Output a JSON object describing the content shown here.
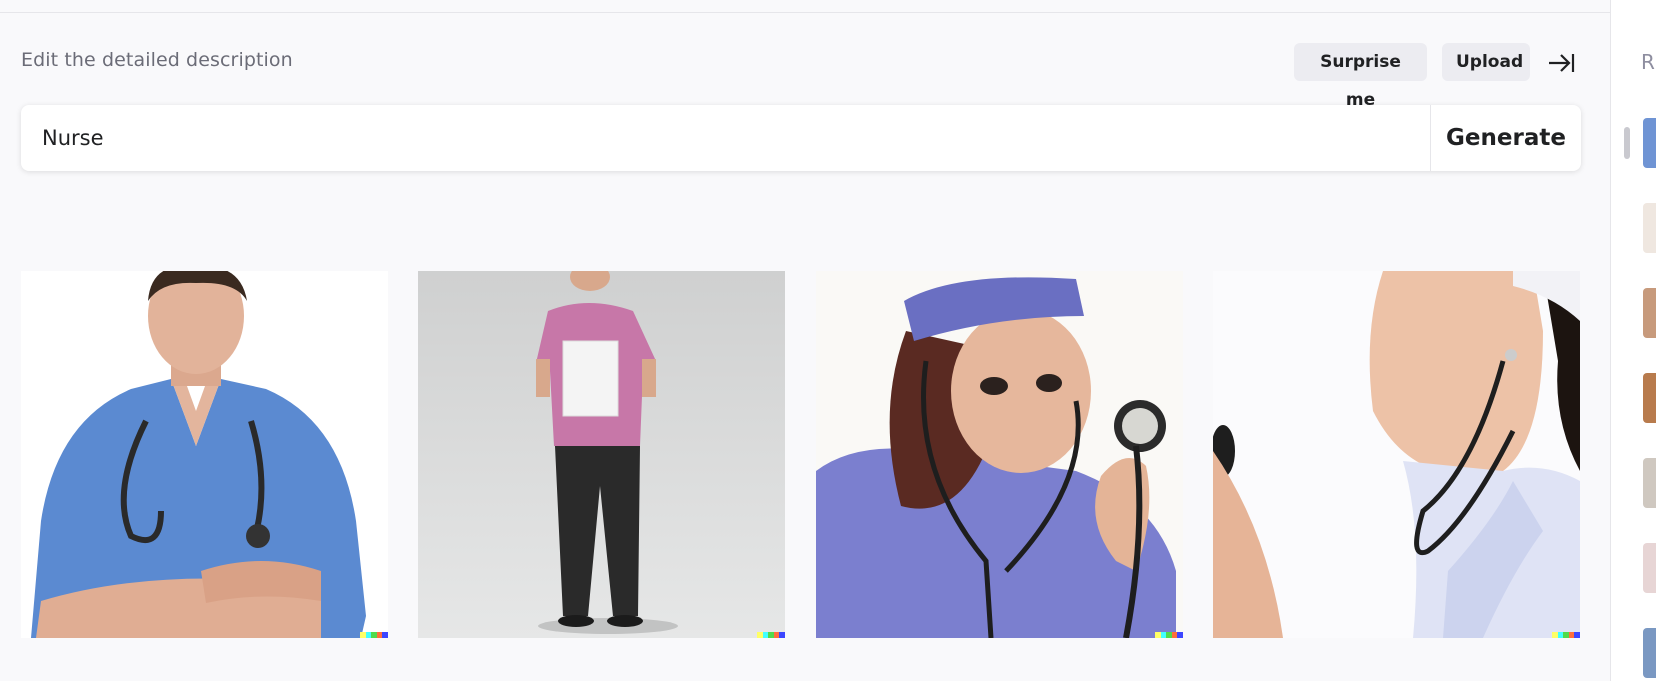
{
  "header": {
    "description_label": "Edit the detailed description",
    "surprise_label": "Surprise me",
    "upload_label": "Upload"
  },
  "prompt": {
    "value": "Nurse",
    "generate_label": "Generate"
  },
  "results": [
    {
      "subject": "male nurse in blue scrubs with stethoscope, arms crossed"
    },
    {
      "subject": "nurse in pink tunic and black trousers holding papers"
    },
    {
      "subject": "nurse in purple scrubs and cap holding stethoscope"
    },
    {
      "subject": "nurse in light blue uniform with stethoscope, close-up"
    }
  ],
  "watermark_colors": [
    "#ffff66",
    "#42ffff",
    "#51da4c",
    "#ff6e3c",
    "#3c46ff"
  ],
  "history": {
    "label_initial": "R"
  },
  "colors": {
    "background": "#f9f9fb",
    "button_bg": "#ececf1",
    "text": "#202123",
    "muted": "#6b6c77"
  }
}
